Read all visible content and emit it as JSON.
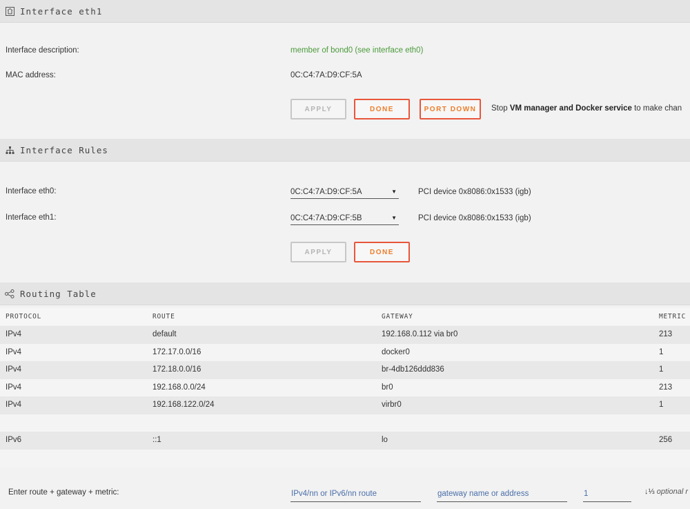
{
  "interface": {
    "title": "Interface eth1",
    "desc_label": "Interface description:",
    "desc_value": "member of bond0 (see interface eth0)",
    "mac_label": "MAC address:",
    "mac_value": "0C:C4:7A:D9:CF:5A",
    "apply": "APPLY",
    "done": "DONE",
    "port_down": "PORT DOWN",
    "note_prefix": "Stop ",
    "note_bold": "VM manager and Docker service",
    "note_suffix": " to make chan"
  },
  "rules": {
    "title": "Interface Rules",
    "rows": [
      {
        "label": "Interface eth0:",
        "mac": "0C:C4:7A:D9:CF:5A",
        "pci": "PCI device 0x8086:0x1533 (igb)"
      },
      {
        "label": "Interface eth1:",
        "mac": "0C:C4:7A:D9:CF:5B",
        "pci": "PCI device 0x8086:0x1533 (igb)"
      }
    ],
    "apply": "APPLY",
    "done": "DONE"
  },
  "routing": {
    "title": "Routing Table",
    "columns": [
      "PROTOCOL",
      "ROUTE",
      "GATEWAY",
      "METRIC"
    ],
    "rows": [
      [
        "IPv4",
        "default",
        "192.168.0.112 via br0",
        "213"
      ],
      [
        "IPv4",
        "172.17.0.0/16",
        "docker0",
        "1"
      ],
      [
        "IPv4",
        "172.18.0.0/16",
        "br-4db126ddd836",
        "1"
      ],
      [
        "IPv4",
        "192.168.0.0/24",
        "br0",
        "213"
      ],
      [
        "IPv4",
        "192.168.122.0/24",
        "virbr0",
        "1"
      ],
      [
        "",
        "",
        "",
        ""
      ],
      [
        "IPv6",
        "::1",
        "lo",
        "256"
      ],
      [
        "",
        "",
        "",
        ""
      ]
    ],
    "enter_label": "Enter route + gateway + metric:",
    "route_placeholder": "IPv4/nn or IPv6/nn route",
    "gateway_placeholder": "gateway name or address",
    "metric_value": "1",
    "sort_icon": "↓⅓",
    "optional_text": "optional r"
  }
}
